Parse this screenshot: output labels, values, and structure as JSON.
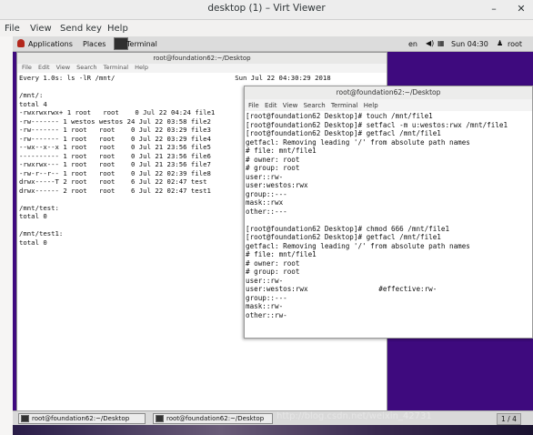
{
  "window": {
    "title": "desktop (1) – Virt Viewer",
    "minimize_glyph": "–",
    "maximize_glyph": "□",
    "close_glyph": "✕"
  },
  "menubar": {
    "items": [
      "File",
      "View",
      "Send key",
      "Help"
    ]
  },
  "gnome_bar": {
    "applications": "Applications",
    "places": "Places",
    "terminal": "Terminal",
    "lang": "en",
    "clock": "Sun 04:30",
    "user": "root"
  },
  "term1": {
    "title": "root@foundation62:~/Desktop",
    "menu": [
      "File",
      "Edit",
      "View",
      "Search",
      "Terminal",
      "Help"
    ],
    "content": "Every 1.0s: ls -lR /mnt/                              Sun Jul 22 04:30:29 2018\n\n/mnt/:\ntotal 4\n-rwxrwxrwx+ 1 root   root    0 Jul 22 04:24 file1\n-rw------- 1 westos westos 24 Jul 22 03:58 file2\n-rw------- 1 root   root    0 Jul 22 03:29 file3\n-rw------- 1 root   root    0 Jul 22 03:29 file4\n--wx--x--x 1 root   root    0 Jul 21 23:56 file5\n---------- 1 root   root    0 Jul 21 23:56 file6\n-rwxrwx--- 1 root   root    0 Jul 21 23:56 file7\n-rw-r--r-- 1 root   root    0 Jul 22 02:39 file8\ndrwx-----T 2 root   root    6 Jul 22 02:47 test\ndrwx------ 2 root   root    6 Jul 22 02:47 test1\n\n/mnt/test:\ntotal 0\n\n/mnt/test1:\ntotal 0"
  },
  "term2": {
    "title": "root@foundation62:~/Desktop",
    "menu": [
      "File",
      "Edit",
      "View",
      "Search",
      "Terminal",
      "Help"
    ],
    "content": "[root@foundation62 Desktop]# touch /mnt/file1\n[root@foundation62 Desktop]# setfacl -m u:westos:rwx /mnt/file1\n[root@foundation62 Desktop]# getfacl /mnt/file1\ngetfacl: Removing leading '/' from absolute path names\n# file: mnt/file1\n# owner: root\n# group: root\nuser::rw-\nuser:westos:rwx\ngroup::---\nmask::rwx\nother::---\n\n[root@foundation62 Desktop]# chmod 666 /mnt/file1\n[root@foundation62 Desktop]# getfacl /mnt/file1\ngetfacl: Removing leading '/' from absolute path names\n# file: mnt/file1\n# owner: root\n# group: root\nuser::rw-\nuser:westos:rwx                 #effective:rw-\ngroup::---\nmask::rw-\nother::rw-"
  },
  "taskbar": {
    "tasks": [
      "root@foundation62:~/Desktop",
      "root@foundation62:~/Desktop"
    ],
    "workspace": "1 / 4"
  },
  "watermark": "http://blog.csdn.net/weixin_42731"
}
